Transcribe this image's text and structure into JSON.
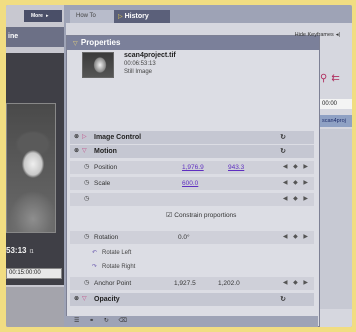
{
  "left_window": {
    "more_tab": "More",
    "more_arrow": "▸",
    "title": "ine",
    "timecode": "53:13",
    "timecode_mark": "I1",
    "timecode_field": "00:15:00:00"
  },
  "tabs": [
    {
      "label": "How To"
    },
    {
      "label": "History",
      "arrow": "▷"
    }
  ],
  "properties": {
    "title_mark": "▽",
    "title": "Properties",
    "hide_keyframes": "Hide Keyframes",
    "hide_keyframes_icon": "◂|",
    "file": {
      "name": "scan4project.tif",
      "timecode": "00:06:53:13",
      "type": "Still Image"
    },
    "image_control": {
      "label": "Image Control",
      "reset": "↻"
    },
    "motion": {
      "label": "Motion",
      "reset": "↻"
    },
    "position": {
      "label": "Position",
      "x": "1,976.9",
      "y": "943.3"
    },
    "scale": {
      "label": "Scale",
      "value": "600.0"
    },
    "constrain": {
      "label": "Constrain proportions",
      "checked": true
    },
    "rotation": {
      "label": "Rotation",
      "value": "0.0°"
    },
    "rotate_left": "Rotate Left",
    "rotate_right": "Rotate Right",
    "anchor_point": {
      "label": "Anchor Point",
      "x": "1,927.5",
      "y": "1,202.0"
    },
    "opacity": {
      "label": "Opacity",
      "reset": "↻"
    },
    "keyframe_controls": "◀ ◆ ▶"
  },
  "timeline": {
    "time": "00:00",
    "clip_name": "scan4proj"
  },
  "icons": {
    "zoom": "zoom-icon",
    "toggle": "triangle-icon",
    "stopwatch": "stopwatch-icon"
  },
  "colors": {
    "background": "#f1dd82",
    "panel": "#dcdde4",
    "title_bar": "#7b809a",
    "value_link": "#5f2fc0",
    "accent": "#c0387a"
  }
}
